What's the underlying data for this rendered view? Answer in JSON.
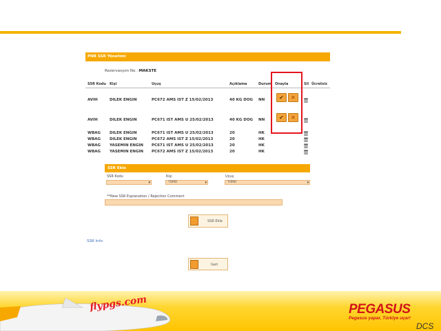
{
  "header": {
    "title": "PNR SSR Yönetimi"
  },
  "reservation": {
    "label": "Rezervasyon No. :",
    "value": "MAKSTE"
  },
  "table": {
    "columns": [
      "SSR Kodu",
      "Kişi",
      "Uçuş",
      "Açıklama",
      "Durum",
      "Onayla",
      "Sil",
      "Ücretsiz"
    ],
    "rows": [
      {
        "code": "AVIH",
        "person": "DILEK ENGIN",
        "flight": "PC672 AMS IST Z 15/02/2013",
        "desc": "40 KG DOG",
        "status": "NN",
        "approve": true
      },
      {
        "code": "AVIH",
        "person": "DILEK ENGIN",
        "flight": "PC671 IST AMS U 25/02/2013",
        "desc": "40 KG DOG",
        "status": "NN",
        "approve": true
      },
      {
        "code": "WBAG",
        "person": "DILEK ENGIN",
        "flight": "PC671 IST AMS U 25/02/2013",
        "desc": "20",
        "status": "HK",
        "approve": false
      },
      {
        "code": "WBAG",
        "person": "DILEK ENGIN",
        "flight": "PC672 AMS IST Z 15/02/2013",
        "desc": "20",
        "status": "HK",
        "approve": false
      },
      {
        "code": "WBAG",
        "person": "YASEMIN ENGIN",
        "flight": "PC671 IST AMS U 25/02/2013",
        "desc": "20",
        "status": "HK",
        "approve": false
      },
      {
        "code": "WBAG",
        "person": "YASEMIN ENGIN",
        "flight": "PC672 AMS IST Z 15/02/2013",
        "desc": "20",
        "status": "HK",
        "approve": false
      }
    ]
  },
  "ssr_add": {
    "title": "SSR Ekle",
    "code_label": "SSR Kodu",
    "person_label": "Kişi",
    "person_value": "TÜMÜ",
    "flight_label": "Uçuş",
    "flight_value": "TÜMÜ",
    "comment_label": "**New SSR Explanation / Rejection Comment",
    "add_button": "SSR Ekle"
  },
  "ssr_info_link": "SSR Info",
  "back_button": "Geri",
  "footer": {
    "fly_text": "flypgs.com",
    "brand": "PEGASUS",
    "slogan": "Pegasus yapar, Türkiye uçar!",
    "dcs": "DCS"
  },
  "colors": {
    "accent": "#f6a800",
    "highlight": "#e4141d",
    "brand_red": "#d1131a"
  }
}
